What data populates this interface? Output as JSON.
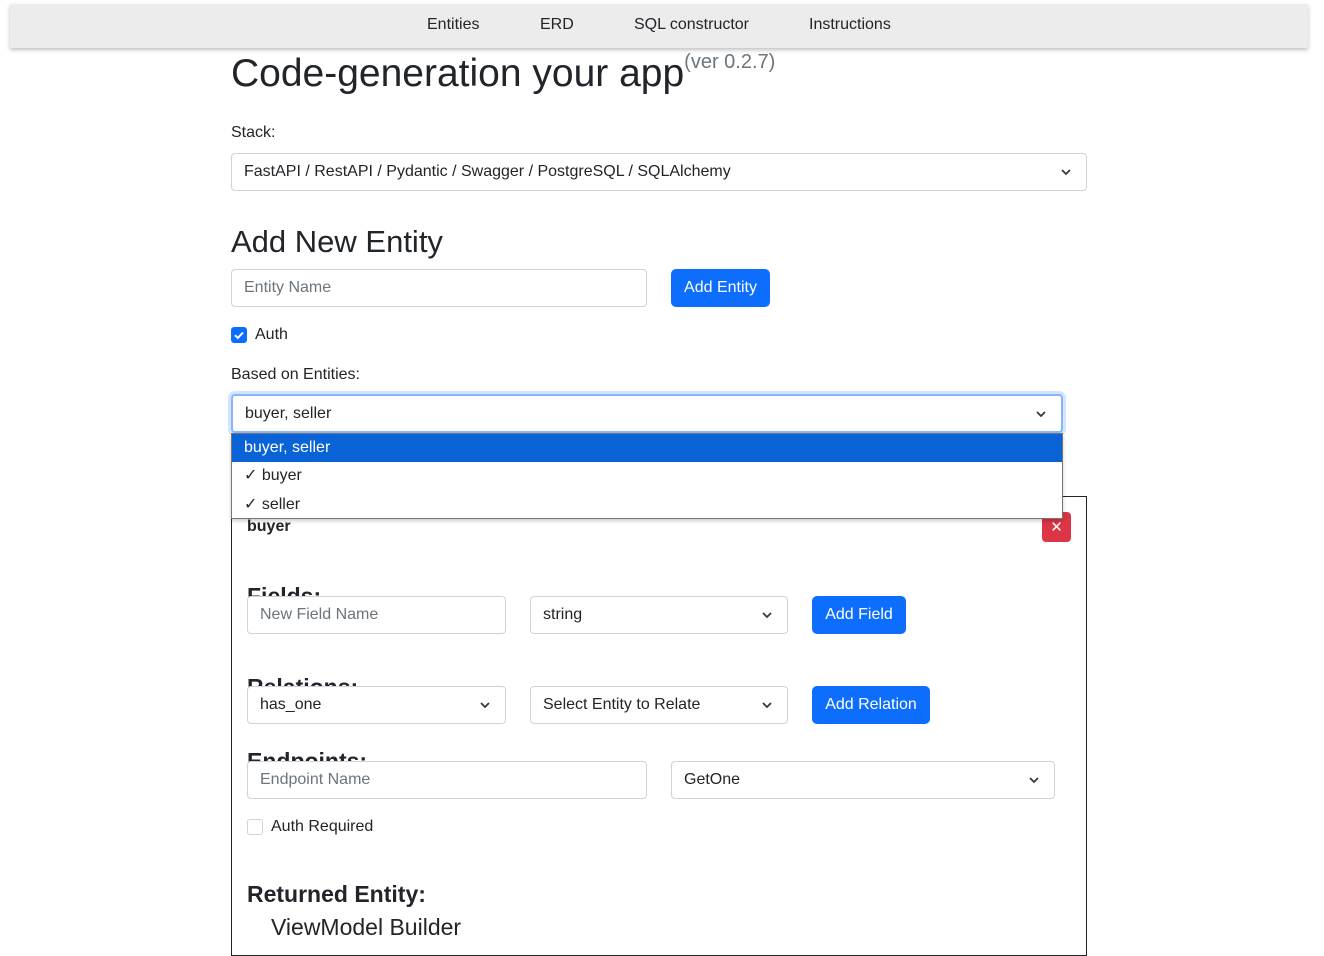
{
  "nav": {
    "items": [
      "Entities",
      "ERD",
      "SQL constructor",
      "Instructions"
    ]
  },
  "header": {
    "title": "Code-generation your app",
    "version": "(ver 0.2.7)"
  },
  "stack": {
    "label": "Stack:",
    "selected": "FastAPI / RestAPI / Pydantic / Swagger / PostgreSQL / SQLAlchemy"
  },
  "add_entity": {
    "heading": "Add New Entity",
    "name_placeholder": "Entity Name",
    "add_button": "Add Entity",
    "auth_label": "Auth",
    "auth_checked": true,
    "based_on_label": "Based on Entities:",
    "based_on_selected": "buyer, seller",
    "based_on_options": [
      {
        "label": "buyer, seller",
        "highlighted": true
      },
      {
        "label": "✓ buyer",
        "highlighted": false
      },
      {
        "label": "✓ seller",
        "highlighted": false
      }
    ]
  },
  "entity": {
    "name": "buyer",
    "close_glyph": "✕",
    "fields_heading": "Fields:",
    "field_name_placeholder": "New Field Name",
    "field_type_selected": "string",
    "add_field_button": "Add Field",
    "relations_heading": "Relations:",
    "relation_type_selected": "has_one",
    "relation_entity_selected": "Select Entity to Relate",
    "add_relation_button": "Add Relation",
    "endpoints_heading": "Endpoints:",
    "endpoint_name_placeholder": "Endpoint Name",
    "endpoint_method_selected": "GetOne",
    "auth_required_label": "Auth Required",
    "auth_required_checked": false,
    "returned_entity_heading": "Returned Entity:",
    "viewmodel_builder_label": "ViewModel Builder"
  },
  "colors": {
    "primary": "#0d6efd",
    "danger": "#dc3545",
    "navbar_bg": "#ececec",
    "dropdown_highlight": "#0a63d6"
  }
}
